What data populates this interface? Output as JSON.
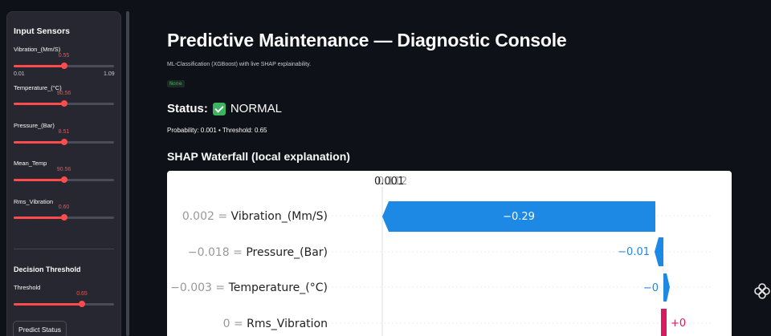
{
  "sidebar": {
    "inputs_title": "Input Sensors",
    "sliders": [
      {
        "label": "Vibration_(Mm/S)",
        "value": "0.55",
        "fraction": 0.5,
        "min": "0.01",
        "max": "1.09"
      },
      {
        "label": "Temperature_(°C)",
        "value": "90.56",
        "fraction": 0.5
      },
      {
        "label": "Pressure_(Bar)",
        "value": "8.51",
        "fraction": 0.5
      },
      {
        "label": "Mean_Temp",
        "value": "90.56",
        "fraction": 0.5
      },
      {
        "label": "Rms_Vibration",
        "value": "0.60",
        "fraction": 0.5
      }
    ],
    "threshold_title": "Decision Threshold",
    "threshold": {
      "label": "Threshold",
      "value": "0.65",
      "fraction": 0.68
    },
    "predict_label": "Predict Status"
  },
  "main": {
    "title": "Predictive Maintenance — Diagnostic Console",
    "subtitle": "ML-Classification (XGBoost) with live SHAP explainability.",
    "badge": "None",
    "status_label": "Status:",
    "status_value": "NORMAL",
    "prob_line": "Probability: 0.001 • Threshold: 0.65",
    "shap_title": "SHAP Waterfall (local explanation)"
  },
  "colors": {
    "accent": "#ff4b4b",
    "negative": "#1e88e5",
    "positive": "#d81b60",
    "ok": "#21c354"
  },
  "chart_data": {
    "type": "bar",
    "top_labels": [
      "0.001",
      "0.112"
    ],
    "features": [
      {
        "label": "0.002 = Vibration_(Mm/S)",
        "shap": -0.29,
        "text": "−0.29",
        "sign": "negative"
      },
      {
        "label": "−0.018 = Pressure_(Bar)",
        "shap": -0.01,
        "text": "−0.01",
        "sign": "negative"
      },
      {
        "label": "−0.003 = Temperature_(°C)",
        "shap": 0.0,
        "text": "−0",
        "sign": "negative-small"
      },
      {
        "label": "0 = Rms_Vibration",
        "shap": 0.0,
        "text": "+0",
        "sign": "positive"
      }
    ]
  }
}
